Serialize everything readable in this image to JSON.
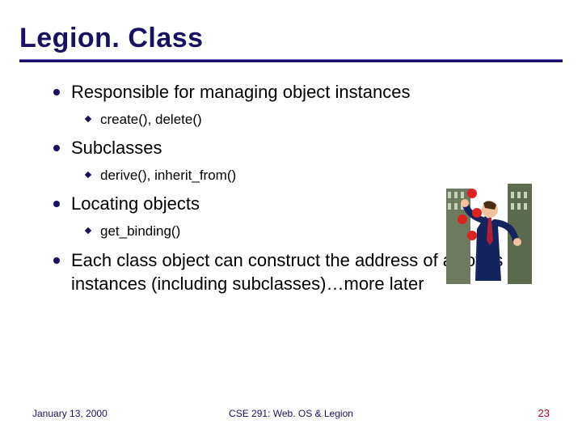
{
  "title": "Legion. Class",
  "bullets": {
    "b0": {
      "text": "Responsible for managing object instances",
      "sub": "create(), delete()"
    },
    "b1": {
      "text": "Subclasses",
      "sub": "derive(), inherit_from()"
    },
    "b2": {
      "text": "Locating objects",
      "sub": "get_binding()"
    },
    "b3": {
      "text": "Each class object can construct the address of all of its instances (including subclasses)…more later"
    }
  },
  "footer": {
    "date": "January 13, 2000",
    "course": "CSE 291: Web. OS & Legion",
    "page": "23"
  }
}
